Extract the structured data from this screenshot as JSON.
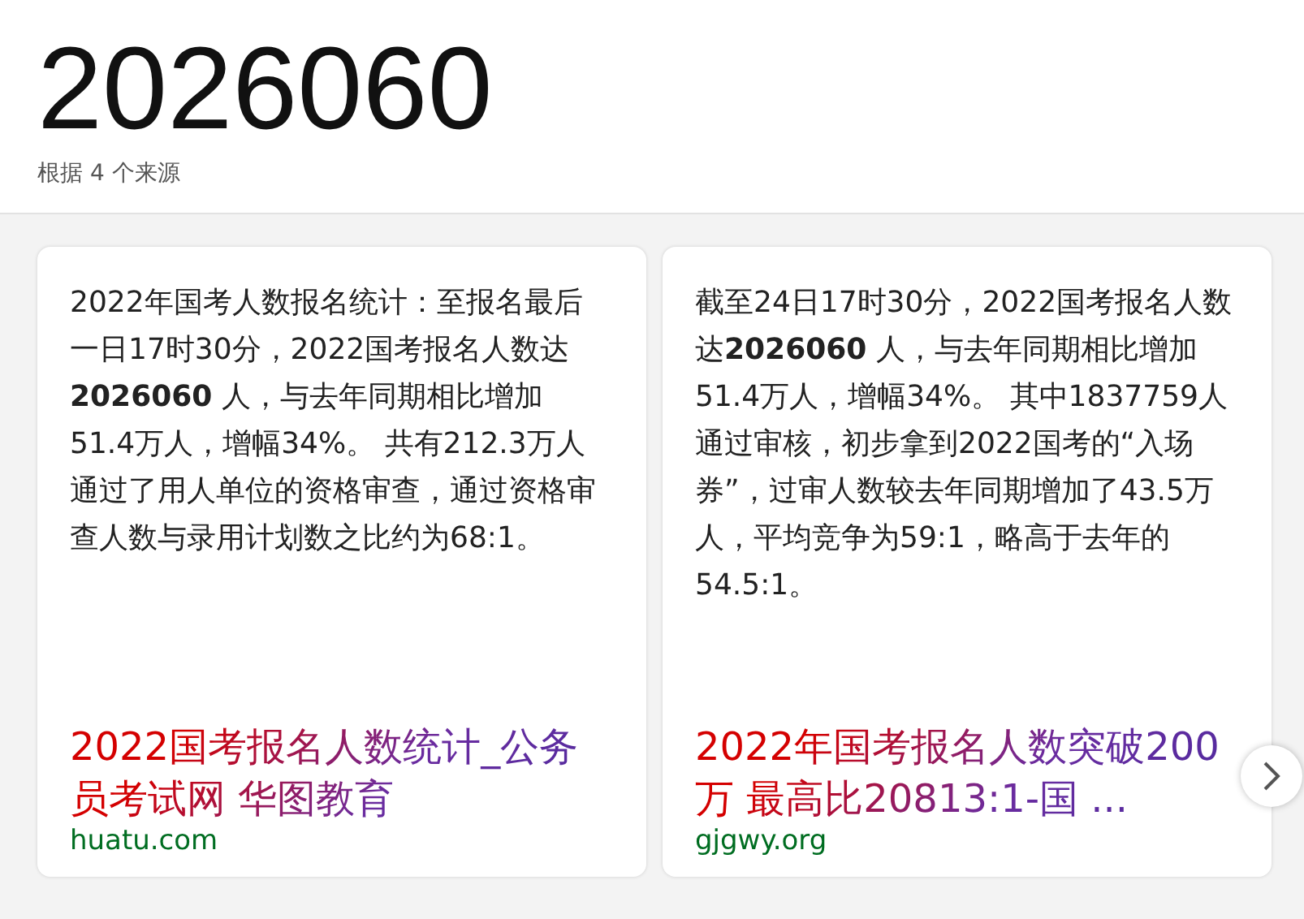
{
  "answer": {
    "value": "2026060",
    "sources": "根据 4 个来源"
  },
  "cards": [
    {
      "text": "2022年国考人数报名统计：至报名最后一日17时30分，2022国考报名人数达**2026060** 人，与去年同期相比增加51.4万人，增幅34%。 共有212.3万人通过了用人单位的资格审查，通过资格审查人数与录用计划数之比约为68:1。",
      "title": "2022国考报名人数统计_公务员考试网 华图教育",
      "site": "huatu.com"
    },
    {
      "text": "截至24日17时30分，2022国考报名人数达**2026060** 人，与去年同期相比增加51.4万人，增幅34%。 其中1837759人通过审核，初步拿到2022国考的“入场券”，过审人数较去年同期增加了43.5万人，平均竞争为59:1，略高于去年的54.5:1。",
      "title": "2022年国考报名人数突破200万 最高比20813:1-国 ...",
      "site": "gjgwy.org"
    }
  ]
}
